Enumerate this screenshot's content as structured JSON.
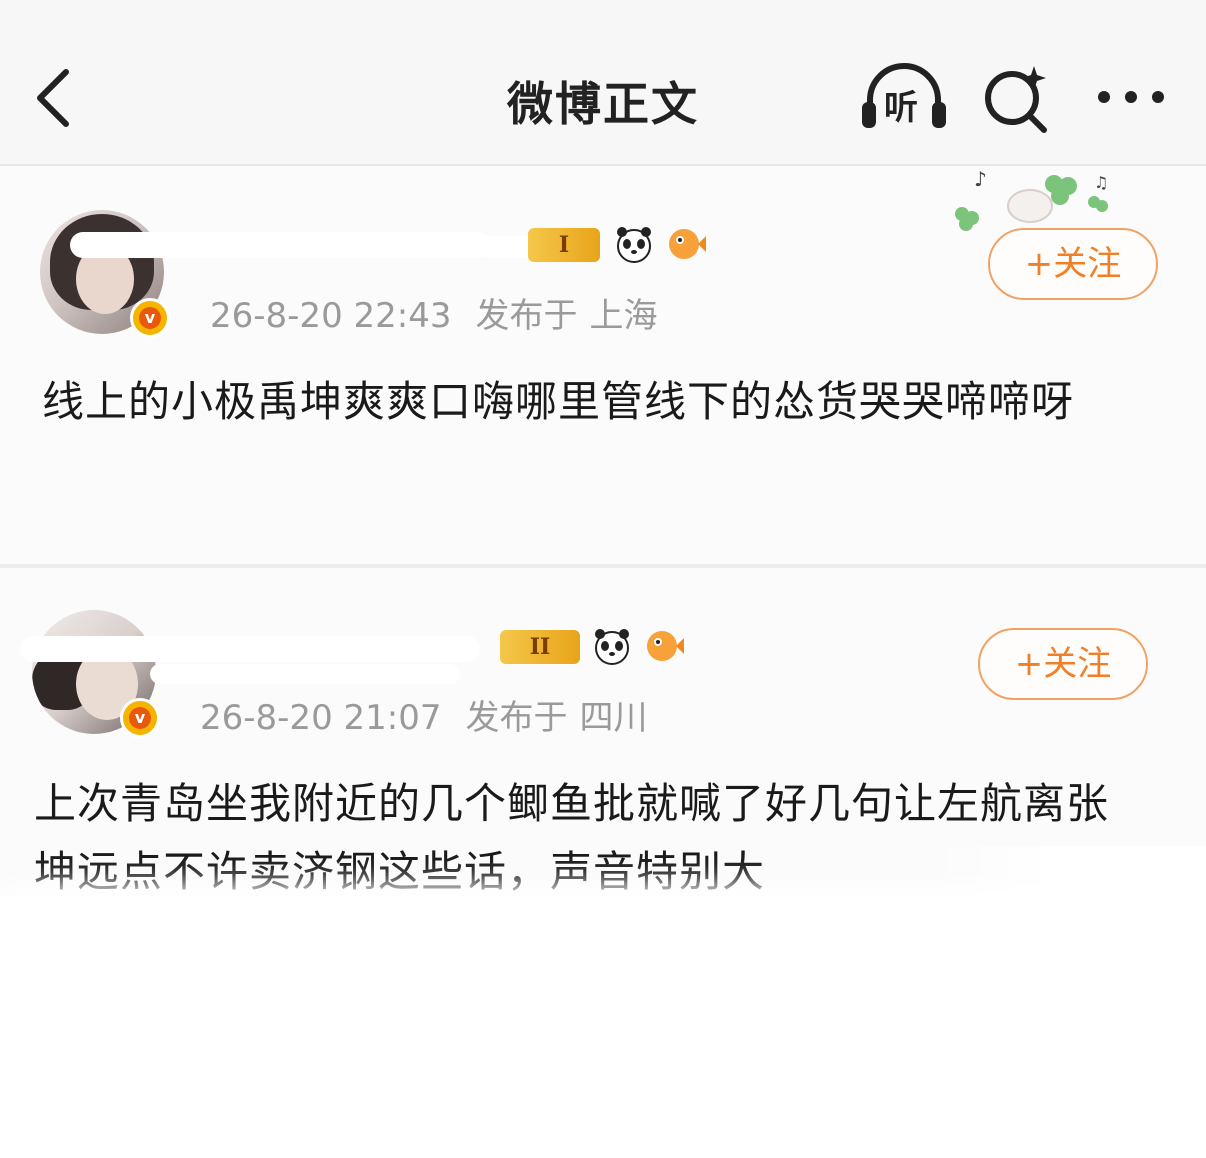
{
  "header": {
    "title": "微博正文",
    "listen_label": "听",
    "icons": [
      "back-icon",
      "listen-headphones-icon",
      "search-sparkle-icon",
      "more-dots-icon"
    ]
  },
  "posts": [
    {
      "time": "26-8-20 22:43",
      "location_label": "发布于",
      "location": "上海",
      "follow_label": "+关注",
      "level_badge": "I",
      "text": "线上的小极禹坤爽爽口嗨哪里管线下的怂货哭哭啼啼呀",
      "icons": [
        "avatar",
        "verified-v-icon",
        "panda-icon",
        "pufferfish-icon",
        "clover-decoration-icon"
      ]
    },
    {
      "time": "26-8-20 21:07",
      "location_label": "发布于",
      "location": "四川",
      "follow_label": "+关注",
      "level_badge": "II",
      "text": "上次青岛坐我附近的几个鲫鱼批就喊了好几句让左航离张坤远点不许卖济钢这些话，声音特别大",
      "icons": [
        "avatar",
        "verified-v-icon",
        "panda-icon",
        "pufferfish-icon"
      ]
    }
  ],
  "colors": {
    "accent": "#f08028",
    "follow_border": "#f0a264",
    "meta_text": "#9a9a9a",
    "badge_gold": "#f5b400",
    "header_bg": "#f7f7f7"
  }
}
